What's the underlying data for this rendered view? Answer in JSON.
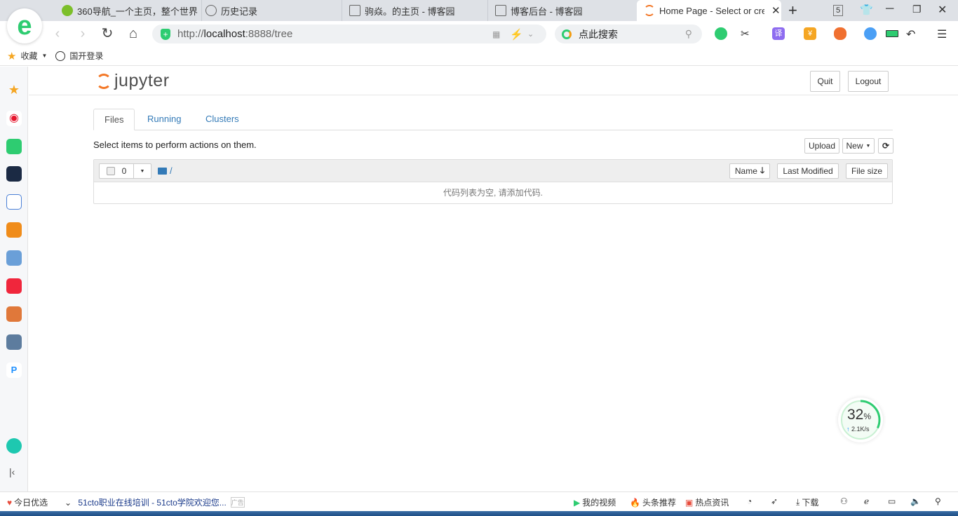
{
  "browser": {
    "tabs": [
      {
        "label": "360导航_一个主页，整个世界",
        "icon": "360-nav-icon"
      },
      {
        "label": "历史记录",
        "icon": "clock-icon"
      },
      {
        "label": "驹焱。的主页 - 博客园",
        "icon": "cnblogs-icon"
      },
      {
        "label": "博客后台 - 博客园",
        "icon": "cnblogs-icon"
      },
      {
        "label": "Home Page - Select or create a notebook",
        "icon": "jupyter-icon",
        "active": true
      }
    ],
    "tab_count": "5",
    "url_prefix": "http://",
    "url_host": "localhost",
    "url_rest": ":8888/tree",
    "search_placeholder": "点此搜索",
    "bookmarks": [
      {
        "label": "收藏"
      },
      {
        "label": "国开登录"
      }
    ],
    "status_left": "今日优选",
    "status_news": "51cto职业在线培训 - 51cto学院欢迎您...",
    "status_ad": "广告",
    "status_right": [
      "我的视频",
      "头条推荐",
      "热点资讯"
    ],
    "download": "下载",
    "net_percent": "32",
    "net_percent_unit": "%",
    "net_speed": "2.1K/s",
    "net_level": 0.32
  },
  "jupyter": {
    "logo_text": "jupyter",
    "quit": "Quit",
    "logout": "Logout",
    "tabs": [
      "Files",
      "Running",
      "Clusters"
    ],
    "active_tab": "Files",
    "hint": "Select items to perform actions on them.",
    "upload": "Upload",
    "new": "New",
    "selected_count": "0",
    "path": "/",
    "columns": [
      "Name",
      "Last Modified",
      "File size"
    ],
    "empty_message": "代码列表为空, 请添加代码."
  },
  "colors": {
    "accent": "#337ab7",
    "jupyter_orange": "#f37726",
    "browser_green": "#2ecc71"
  }
}
